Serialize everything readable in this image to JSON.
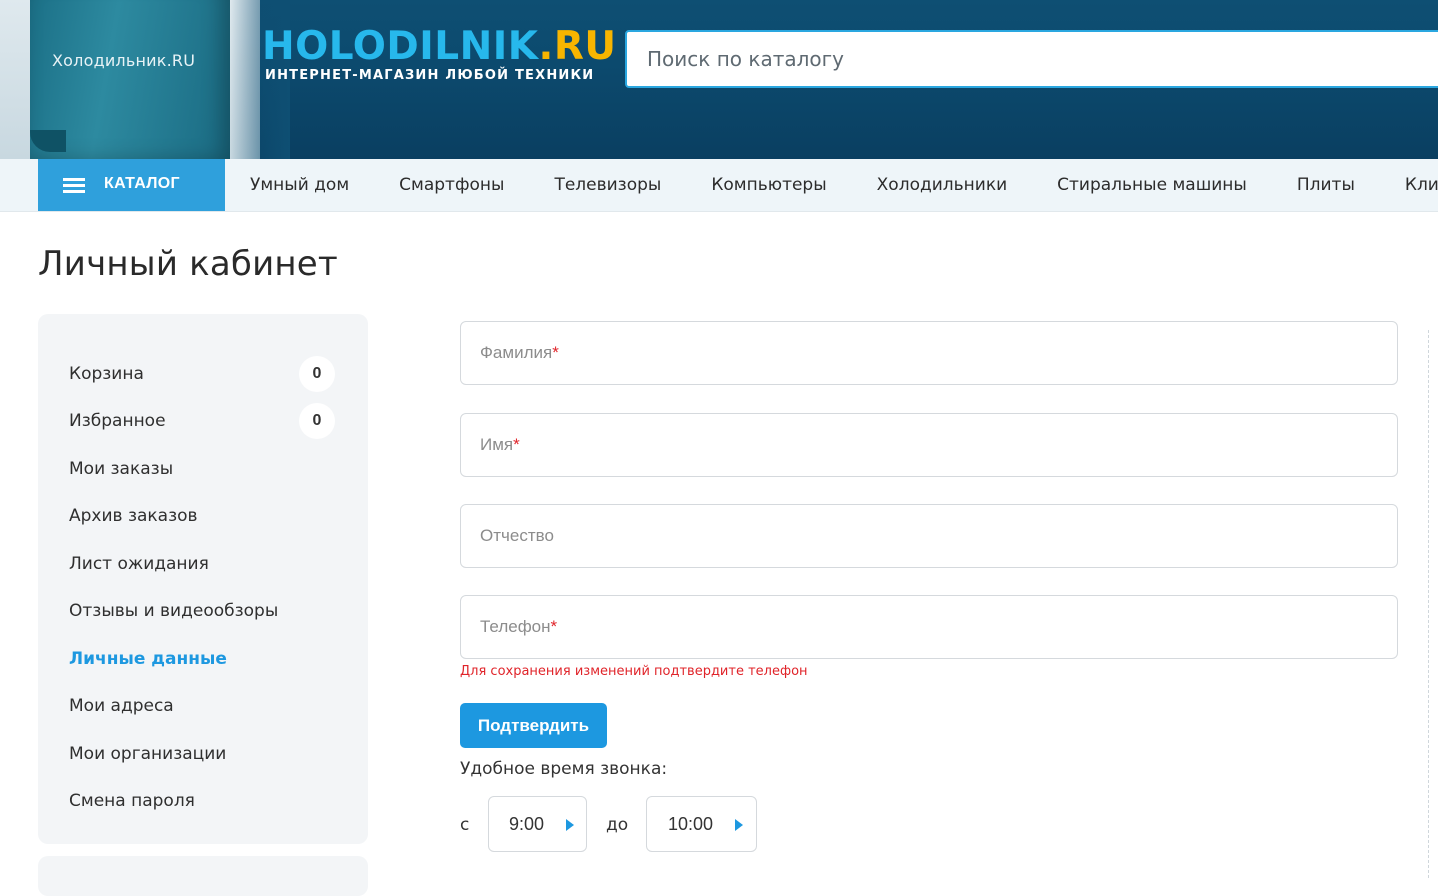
{
  "header": {
    "logo_main": "HOLODILNIK",
    "logo_suffix": ".RU",
    "tagline": "ИНТЕРНЕТ-МАГАЗИН ЛЮБОЙ ТЕХНИКИ",
    "promo_brand": "Холодильник.RU",
    "search_placeholder": "Поиск по каталогу"
  },
  "nav": {
    "catalog_label": "КАТАЛОГ",
    "items": [
      "Умный дом",
      "Смартфоны",
      "Телевизоры",
      "Компьютеры",
      "Холодильники",
      "Стиральные машины",
      "Плиты",
      "Климат"
    ]
  },
  "page": {
    "title": "Личный кабинет"
  },
  "sidebar": {
    "items": [
      {
        "label": "Корзина",
        "badge": "0"
      },
      {
        "label": "Избранное",
        "badge": "0"
      },
      {
        "label": "Мои заказы"
      },
      {
        "label": "Архив заказов"
      },
      {
        "label": "Лист ожидания"
      },
      {
        "label": "Отзывы и видеообзоры"
      },
      {
        "label": "Личные данные",
        "active": true
      },
      {
        "label": "Мои адреса"
      },
      {
        "label": "Мои организации"
      },
      {
        "label": "Смена пароля"
      }
    ]
  },
  "form": {
    "fields": [
      {
        "placeholder": "Фамилия",
        "required_mark": "*"
      },
      {
        "placeholder": "Имя",
        "required_mark": "*"
      },
      {
        "placeholder": "Отчество",
        "required_mark": ""
      },
      {
        "placeholder": "Телефон",
        "required_mark": "*"
      }
    ],
    "phone_warning": "Для сохранения изменений подтвердите телефон",
    "confirm_label": "Подтвердить",
    "call_time_label": "Удобное время звонка:",
    "from_word": "с",
    "from_value": "9:00",
    "to_word": "до",
    "to_value": "10:00"
  },
  "colors": {
    "accent": "#1d98e0",
    "catalog_bg": "#2fa0dc",
    "logo_blue": "#27b8ec",
    "logo_yellow": "#f7b500",
    "error": "#e0242a"
  }
}
